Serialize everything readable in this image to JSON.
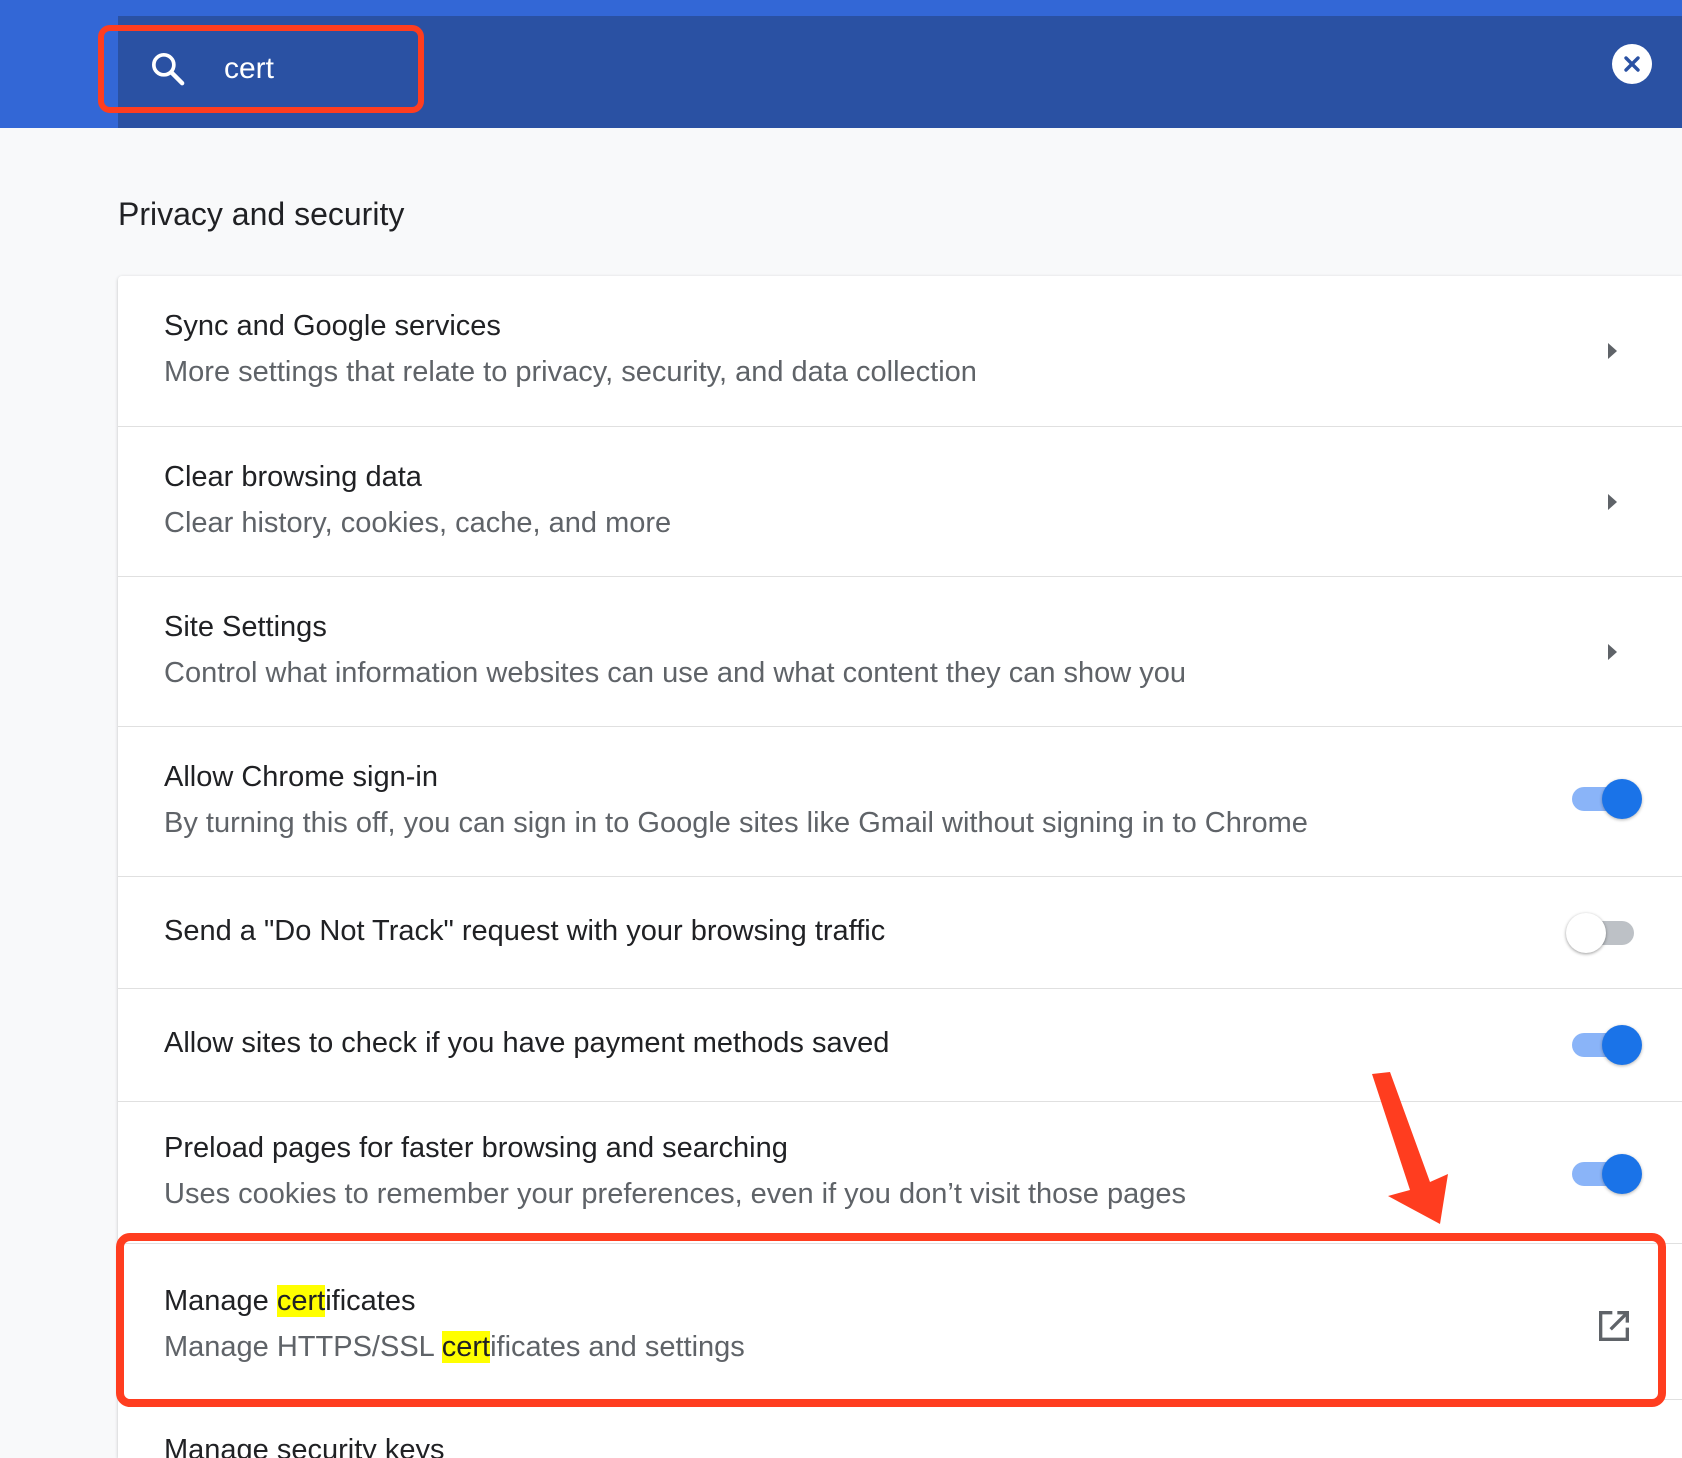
{
  "search": {
    "query": "cert"
  },
  "section": {
    "title": "Privacy and security"
  },
  "rows": [
    {
      "title": "Sync and Google services",
      "subtitle": "More settings that relate to privacy, security, and data collection",
      "control": "chevron"
    },
    {
      "title": "Clear browsing data",
      "subtitle": "Clear history, cookies, cache, and more",
      "control": "chevron"
    },
    {
      "title": "Site Settings",
      "subtitle": "Control what information websites can use and what content they can show you",
      "control": "chevron"
    },
    {
      "title": "Allow Chrome sign-in",
      "subtitle": "By turning this off, you can sign in to Google sites like Gmail without signing in to Chrome",
      "control": "toggle",
      "toggle_on": true
    },
    {
      "title": "Send a \"Do Not Track\" request with your browsing traffic",
      "control": "toggle",
      "toggle_on": false
    },
    {
      "title": "Allow sites to check if you have payment methods saved",
      "control": "toggle",
      "toggle_on": true
    },
    {
      "title": "Preload pages for faster browsing and searching",
      "subtitle": "Uses cookies to remember your preferences, even if you don’t visit those pages",
      "control": "toggle",
      "toggle_on": true
    }
  ],
  "manage_certificates": {
    "title_pre": "Manage ",
    "title_mark": "cert",
    "title_post": "ificates",
    "sub_pre": "Manage HTTPS/SSL ",
    "sub_mark": "cert",
    "sub_post": "ificates and settings",
    "control": "external-link"
  },
  "manage_security_keys": {
    "title": "Manage security keys"
  },
  "colors": {
    "header_blue": "#3367d6",
    "header_dark": "#2a51a3",
    "annotation_red": "#ff3d1f",
    "toggle_on": "#1a73e8",
    "search_highlight": "#ffff00"
  }
}
